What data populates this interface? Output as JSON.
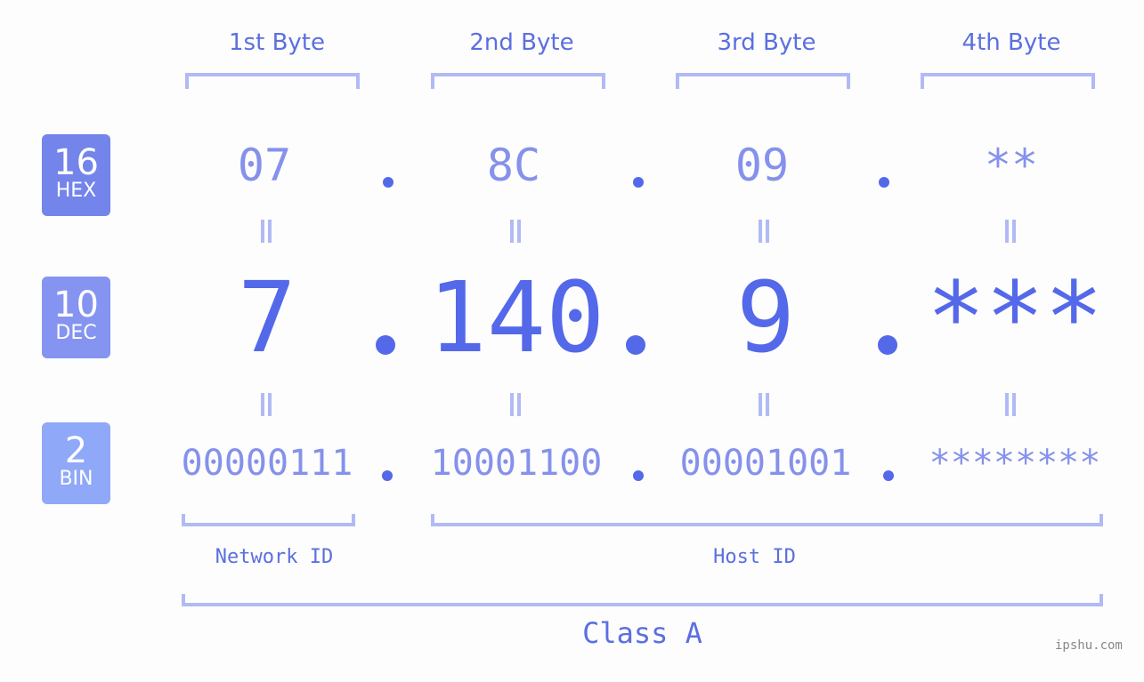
{
  "bytes": {
    "headers": [
      "1st Byte",
      "2nd Byte",
      "3rd Byte",
      "4th Byte"
    ],
    "hex": [
      "07",
      "8C",
      "09",
      "**"
    ],
    "dec": [
      "7",
      "140",
      "9",
      "***"
    ],
    "bin": [
      "00000111",
      "10001100",
      "00001001",
      "********"
    ]
  },
  "bases": [
    {
      "number": "16",
      "name": "HEX",
      "color": "#7384eb"
    },
    {
      "number": "10",
      "name": "DEC",
      "color": "#8594f1"
    },
    {
      "number": "2",
      "name": "BIN",
      "color": "#90a8f8"
    }
  ],
  "segments": {
    "network_label": "Network ID",
    "host_label": "Host ID",
    "class_label": "Class A"
  },
  "watermark": "ipshu.com"
}
